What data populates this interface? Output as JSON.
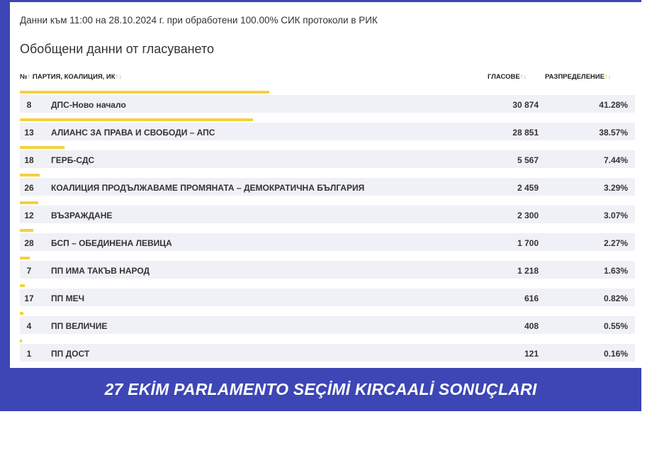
{
  "info": "Данни към 11:00 на 28.10.2024 г. при обработени 100.00% СИК протоколи в РИК",
  "heading": "Обобщени данни от гласуването",
  "table": {
    "col_num": "№",
    "col_party": "ПАРТИЯ, КОАЛИЦИЯ, ИК",
    "col_votes": "ГЛАСОВЕ",
    "col_share": "РАЗПРЕДЕЛЕНИЕ",
    "sort_glyph": "↑↓",
    "rows": [
      {
        "num": "8",
        "party": "ДПС-Ново начало",
        "votes": "30 874",
        "share": "41.28%",
        "pct": 41.28
      },
      {
        "num": "13",
        "party": "АЛИАНС ЗА ПРАВА И СВОБОДИ – АПС",
        "votes": "28 851",
        "share": "38.57%",
        "pct": 38.57
      },
      {
        "num": "18",
        "party": "ГЕРБ-СДС",
        "votes": "5 567",
        "share": "7.44%",
        "pct": 7.44
      },
      {
        "num": "26",
        "party": "КОАЛИЦИЯ ПРОДЪЛЖАВАМЕ ПРОМЯНАТА – ДЕМОКРАТИЧНА БЪЛГАРИЯ",
        "votes": "2 459",
        "share": "3.29%",
        "pct": 3.29
      },
      {
        "num": "12",
        "party": "ВЪЗРАЖДАНЕ",
        "votes": "2 300",
        "share": "3.07%",
        "pct": 3.07
      },
      {
        "num": "28",
        "party": "БСП – ОБЕДИНЕНА ЛЕВИЦА",
        "votes": "1 700",
        "share": "2.27%",
        "pct": 2.27
      },
      {
        "num": "7",
        "party": "ПП ИМА ТАКЪВ НАРОД",
        "votes": "1 218",
        "share": "1.63%",
        "pct": 1.63
      },
      {
        "num": "17",
        "party": "ПП МЕЧ",
        "votes": "616",
        "share": "0.82%",
        "pct": 0.82
      },
      {
        "num": "4",
        "party": "ПП ВЕЛИЧИЕ",
        "votes": "408",
        "share": "0.55%",
        "pct": 0.55
      },
      {
        "num": "1",
        "party": "ПП ДОСТ",
        "votes": "121",
        "share": "0.16%",
        "pct": 0.16
      }
    ]
  },
  "banner": "27 EKİM PARLAMENTO SEÇİMİ KIRCAALİ SONUÇLARI",
  "colors": {
    "frame": "#3d46b4",
    "bar": "#f4d03f",
    "row_bg": "#f0f1f6"
  }
}
